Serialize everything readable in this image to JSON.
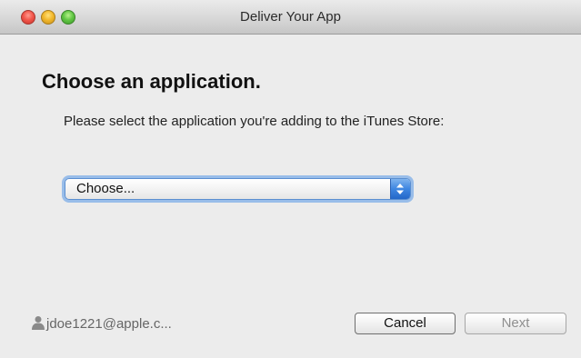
{
  "window": {
    "title": "Deliver Your App"
  },
  "main": {
    "heading": "Choose an application.",
    "instruction": "Please select the application you're adding to the iTunes Store:",
    "app_select": {
      "selected": "Choose..."
    }
  },
  "footer": {
    "account": "jdoe1221@apple.c...",
    "account_icon": "user-icon",
    "cancel_label": "Cancel",
    "next_label": "Next"
  },
  "colors": {
    "close": "#f2574c",
    "minimize": "#f2b82d",
    "zoom": "#62c745",
    "focus_ring": "#76aae8"
  }
}
